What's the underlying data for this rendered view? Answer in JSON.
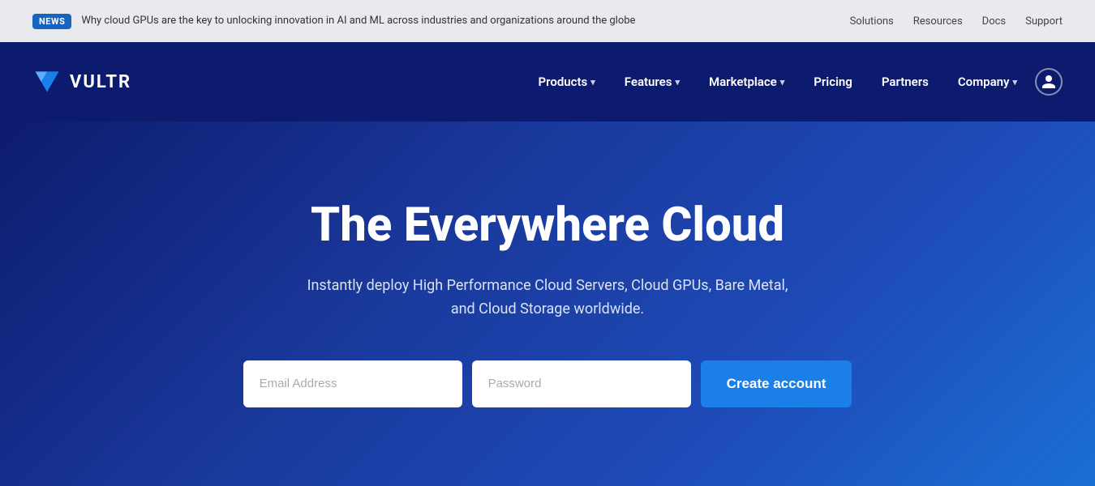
{
  "announcement": {
    "badge": "NEWS",
    "text": "Why cloud GPUs are the key to unlocking innovation in AI and ML across industries and organizations around the globe",
    "links": [
      "Solutions",
      "Resources",
      "Docs",
      "Support"
    ]
  },
  "nav": {
    "logo_text": "VULTR",
    "items": [
      {
        "label": "Products",
        "has_dropdown": true
      },
      {
        "label": "Features",
        "has_dropdown": true
      },
      {
        "label": "Marketplace",
        "has_dropdown": true
      },
      {
        "label": "Pricing",
        "has_dropdown": false
      },
      {
        "label": "Partners",
        "has_dropdown": false
      },
      {
        "label": "Company",
        "has_dropdown": true
      }
    ]
  },
  "hero": {
    "title": "The Everywhere Cloud",
    "subtitle": "Instantly deploy High Performance Cloud Servers, Cloud GPUs, Bare Metal, and Cloud Storage worldwide.",
    "email_placeholder": "Email Address",
    "password_placeholder": "Password",
    "cta_label": "Create account"
  }
}
